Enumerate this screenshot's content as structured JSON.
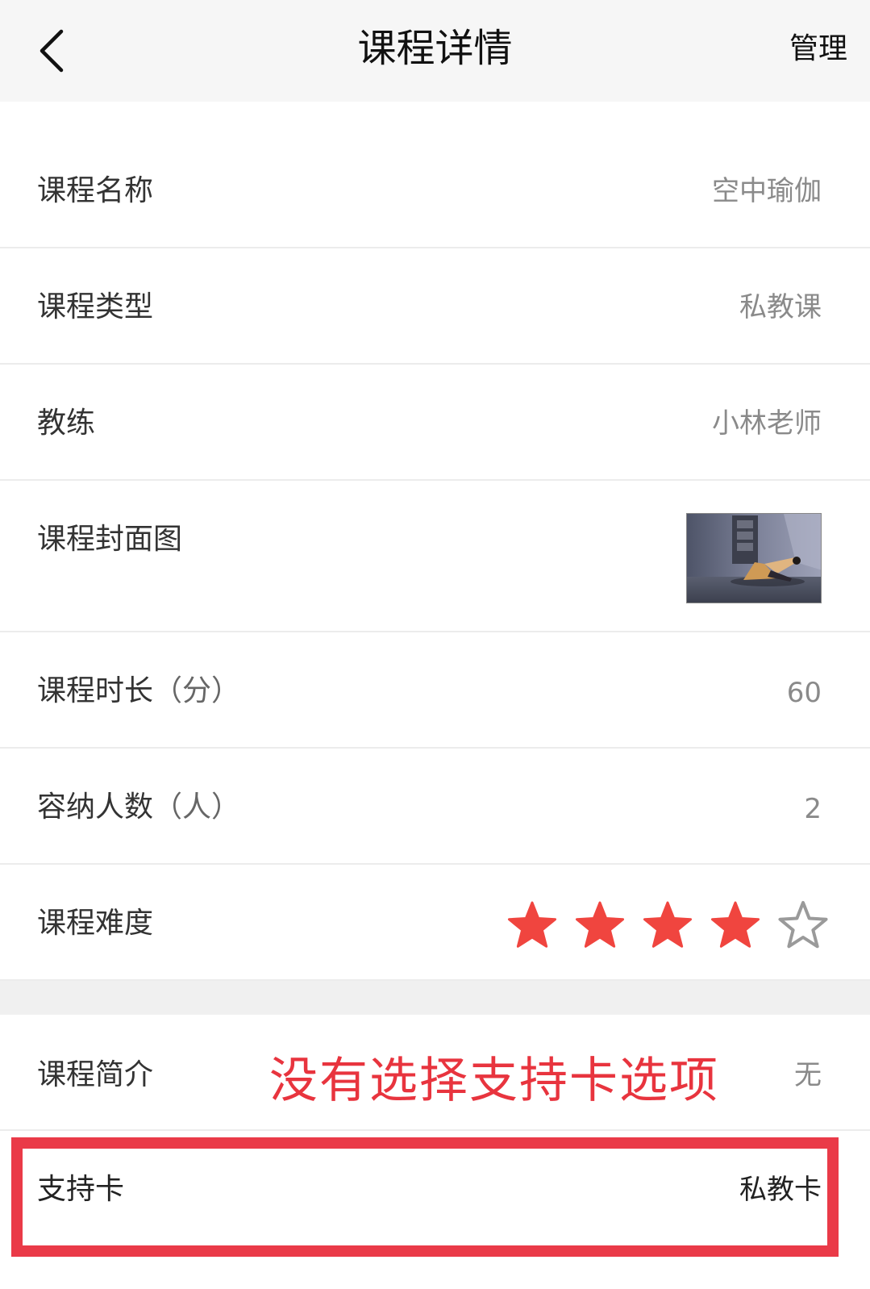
{
  "header": {
    "title": "课程详情",
    "manage_label": "管理"
  },
  "rows": {
    "name": {
      "label": "课程名称",
      "value": "空中瑜伽"
    },
    "type": {
      "label": "课程类型",
      "value": "私教课"
    },
    "coach": {
      "label": "教练",
      "value": "小林老师"
    },
    "cover": {
      "label": "课程封面图"
    },
    "duration": {
      "label": "课程时长",
      "unit": "（分）",
      "value": "60"
    },
    "capacity": {
      "label": "容纳人数",
      "unit": "（人）",
      "value": "2"
    },
    "difficulty": {
      "label": "课程难度",
      "rating": 4,
      "max": 5
    },
    "intro": {
      "label": "课程简介",
      "value": "无"
    },
    "cards": {
      "label": "支持卡",
      "value": "私教卡"
    }
  },
  "annotation": "没有选择支持卡选项",
  "colors": {
    "star_filled": "#f0453f",
    "annotation": "#e8343e",
    "highlight_border": "#ea3a48"
  }
}
